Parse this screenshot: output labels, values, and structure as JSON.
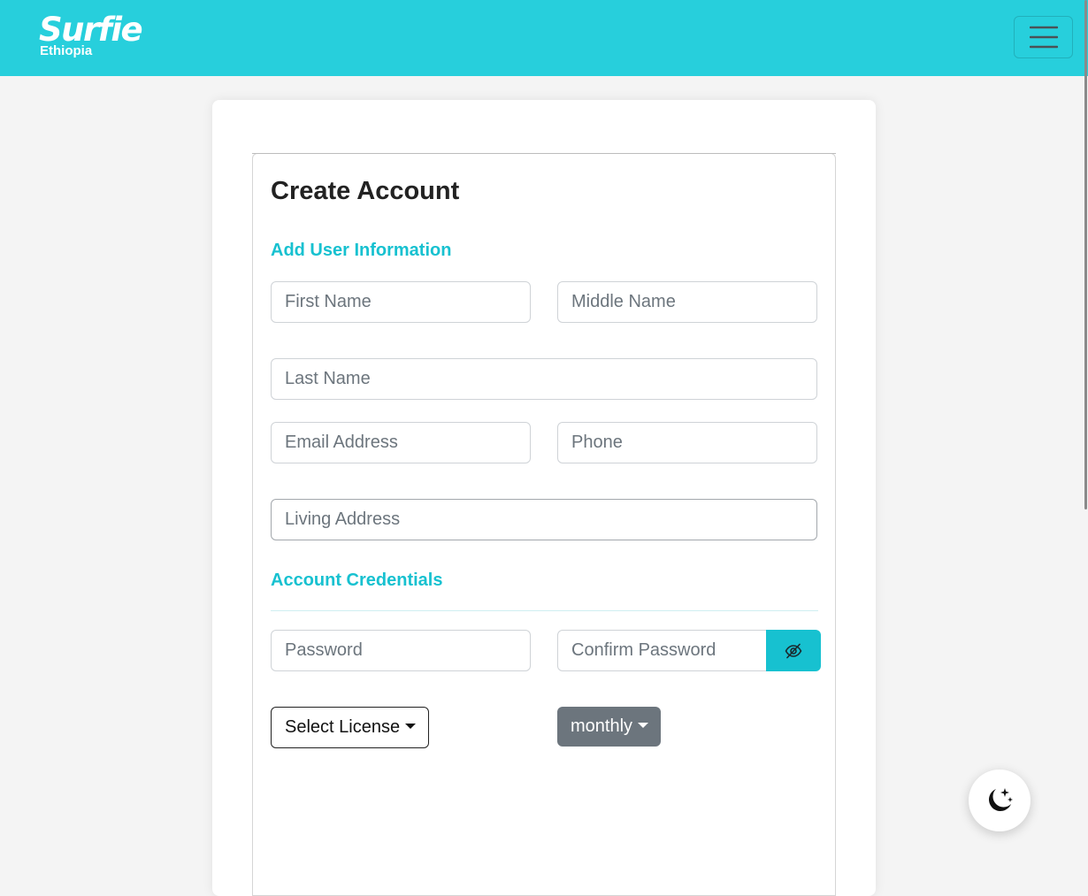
{
  "header": {
    "logo_text": "Surfie",
    "logo_subtext": "Ethiopia",
    "menu_icon": "hamburger-menu-icon",
    "background_color": "#27cfdc"
  },
  "form": {
    "title": "Create Account",
    "user_info_heading": "Add User Information",
    "credentials_heading": "Account Credentials",
    "accent_color": "#17c1d0",
    "fields": {
      "first_name": {
        "placeholder": "First Name",
        "value": ""
      },
      "middle_name": {
        "placeholder": "Middle Name",
        "value": ""
      },
      "last_name": {
        "placeholder": "Last Name",
        "value": ""
      },
      "email": {
        "placeholder": "Email Address",
        "value": ""
      },
      "phone": {
        "placeholder": "Phone",
        "value": ""
      },
      "living_address": {
        "placeholder": "Living Address",
        "value": ""
      },
      "password": {
        "placeholder": "Password",
        "value": ""
      },
      "confirm_password": {
        "placeholder": "Confirm Password",
        "value": ""
      }
    },
    "password_toggle_icon": "eye-slash-icon",
    "license_dropdown": {
      "label": "Select License"
    },
    "billing_period_dropdown": {
      "label": "monthly"
    }
  },
  "theme_toggle": {
    "icon": "moon-stars-icon"
  }
}
